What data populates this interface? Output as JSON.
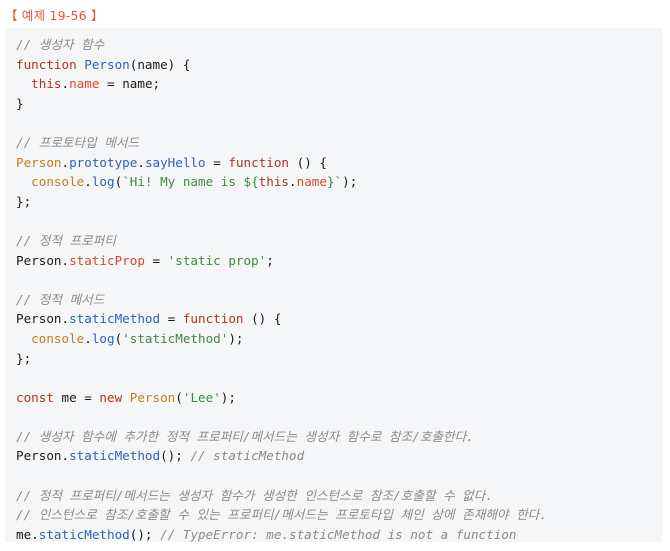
{
  "example": {
    "label": "【 예제 19-56 】"
  },
  "code": {
    "lines": [
      [
        {
          "t": "// 생성자 함수",
          "c": "comment"
        }
      ],
      [
        {
          "t": "function",
          "c": "kw"
        },
        {
          "t": " ",
          "c": "plain"
        },
        {
          "t": "Person",
          "c": "fn"
        },
        {
          "t": "(name) {",
          "c": "plain"
        }
      ],
      [
        {
          "t": "  ",
          "c": "plain"
        },
        {
          "t": "this",
          "c": "kw"
        },
        {
          "t": ".",
          "c": "plain"
        },
        {
          "t": "name",
          "c": "prop"
        },
        {
          "t": " = name;",
          "c": "plain"
        }
      ],
      [
        {
          "t": "}",
          "c": "plain"
        }
      ],
      [],
      [
        {
          "t": "// 프로토타입 메서드",
          "c": "comment"
        }
      ],
      [
        {
          "t": "Person",
          "c": "cls"
        },
        {
          "t": ".",
          "c": "plain"
        },
        {
          "t": "prototype",
          "c": "fn"
        },
        {
          "t": ".",
          "c": "plain"
        },
        {
          "t": "sayHello",
          "c": "fn"
        },
        {
          "t": " = ",
          "c": "plain"
        },
        {
          "t": "function",
          "c": "kw"
        },
        {
          "t": " () {",
          "c": "plain"
        }
      ],
      [
        {
          "t": "  ",
          "c": "plain"
        },
        {
          "t": "console",
          "c": "cls"
        },
        {
          "t": ".",
          "c": "plain"
        },
        {
          "t": "log",
          "c": "fn"
        },
        {
          "t": "(",
          "c": "plain"
        },
        {
          "t": "`Hi! My name is ${",
          "c": "str"
        },
        {
          "t": "this",
          "c": "kw"
        },
        {
          "t": ".",
          "c": "plain"
        },
        {
          "t": "name",
          "c": "prop"
        },
        {
          "t": "}`",
          "c": "str"
        },
        {
          "t": ");",
          "c": "plain"
        }
      ],
      [
        {
          "t": "};",
          "c": "plain"
        }
      ],
      [],
      [
        {
          "t": "// 정적 프로퍼티",
          "c": "comment"
        }
      ],
      [
        {
          "t": "Person",
          "c": "plain"
        },
        {
          "t": ".",
          "c": "plain"
        },
        {
          "t": "staticProp",
          "c": "prop"
        },
        {
          "t": " = ",
          "c": "plain"
        },
        {
          "t": "'static prop'",
          "c": "str"
        },
        {
          "t": ";",
          "c": "plain"
        }
      ],
      [],
      [
        {
          "t": "// 정적 메서드",
          "c": "comment"
        }
      ],
      [
        {
          "t": "Person",
          "c": "plain"
        },
        {
          "t": ".",
          "c": "plain"
        },
        {
          "t": "staticMethod",
          "c": "fn"
        },
        {
          "t": " = ",
          "c": "plain"
        },
        {
          "t": "function",
          "c": "kw"
        },
        {
          "t": " () {",
          "c": "plain"
        }
      ],
      [
        {
          "t": "  ",
          "c": "plain"
        },
        {
          "t": "console",
          "c": "cls"
        },
        {
          "t": ".",
          "c": "plain"
        },
        {
          "t": "log",
          "c": "fn"
        },
        {
          "t": "(",
          "c": "plain"
        },
        {
          "t": "'staticMethod'",
          "c": "str"
        },
        {
          "t": ");",
          "c": "plain"
        }
      ],
      [
        {
          "t": "};",
          "c": "plain"
        }
      ],
      [],
      [
        {
          "t": "const",
          "c": "kw"
        },
        {
          "t": " me = ",
          "c": "plain"
        },
        {
          "t": "new",
          "c": "kw"
        },
        {
          "t": " ",
          "c": "plain"
        },
        {
          "t": "Person",
          "c": "cls"
        },
        {
          "t": "(",
          "c": "plain"
        },
        {
          "t": "'Lee'",
          "c": "str"
        },
        {
          "t": ");",
          "c": "plain"
        }
      ],
      [],
      [
        {
          "t": "// 생성자 함수에 추가한 정적 프로퍼티/메서드는 생성자 함수로 참조/호출한다.",
          "c": "comment"
        }
      ],
      [
        {
          "t": "Person",
          "c": "plain"
        },
        {
          "t": ".",
          "c": "plain"
        },
        {
          "t": "staticMethod",
          "c": "fn"
        },
        {
          "t": "(); ",
          "c": "plain"
        },
        {
          "t": "// staticMethod",
          "c": "comment"
        }
      ],
      [],
      [
        {
          "t": "// 정적 프로퍼티/메서드는 생성자 함수가 생성한 인스턴스로 참조/호출할 수 없다.",
          "c": "comment"
        }
      ],
      [
        {
          "t": "// 인스턴스로 참조/호출할 수 있는 프로퍼티/메서드는 프로토타입 체인 상에 존재해야 한다.",
          "c": "comment"
        }
      ],
      [
        {
          "t": "me",
          "c": "plain"
        },
        {
          "t": ".",
          "c": "plain"
        },
        {
          "t": "staticMethod",
          "c": "fn"
        },
        {
          "t": "(); ",
          "c": "plain"
        },
        {
          "t": "// TypeError: me.staticMethod is not a function",
          "c": "comment"
        }
      ]
    ]
  }
}
